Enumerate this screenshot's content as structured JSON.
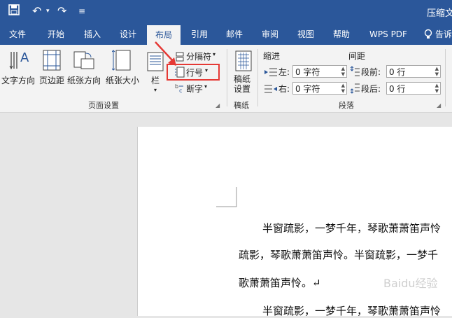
{
  "titlebar": {
    "title": "压缩文",
    "undo_label": "↶",
    "redo_label": "↷",
    "customize_label": "≡"
  },
  "tabs": [
    "文件",
    "开始",
    "插入",
    "设计",
    "布局",
    "引用",
    "邮件",
    "审阅",
    "视图",
    "帮助",
    "WPS PDF",
    "告诉"
  ],
  "active_tab": "布局",
  "page_setup": {
    "text_direction": "文字方向",
    "margins": "页边距",
    "orientation": "纸张方向",
    "size": "纸张大小",
    "columns": "栏",
    "breaks": "分隔符",
    "line_numbers": "行号",
    "hyphenation": "断字",
    "group_label": "页面设置"
  },
  "manuscript": {
    "button": "稿纸\n设置",
    "group_label": "稿纸"
  },
  "paragraph": {
    "indent_header": "缩进",
    "spacing_header": "间距",
    "left_label": "左:",
    "left_value": "0 字符",
    "right_label": "右:",
    "right_value": "0 字符",
    "before_label": "段前:",
    "before_value": "0 行",
    "after_label": "段后:",
    "after_value": "0 行",
    "group_label": "段落"
  },
  "document": {
    "line1": "半窗疏影，一梦千年，琴歌萧萧笛声怜",
    "line2": "疏影，琴歌萧萧笛声怜。半窗疏影，一梦千",
    "line3": "歌萧萧笛声怜。↵",
    "line4": "半窗疏影，一梦千年，琴歌萧萧笛声怜"
  },
  "colors": {
    "accent": "#2b579a",
    "highlight": "#e53935"
  },
  "watermark": "Baidu经验"
}
